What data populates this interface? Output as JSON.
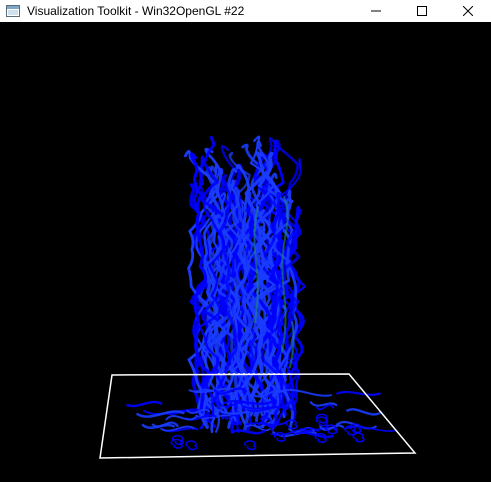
{
  "window": {
    "title": "Visualization Toolkit - Win32OpenGL #22",
    "icon": "vtk-window-icon",
    "controls": [
      "minimize-icon",
      "maximize-icon",
      "close-icon"
    ]
  },
  "render": {
    "background_color": "#000000",
    "outline_color": "#ffffff",
    "streamline_primary_color": "#0000ff",
    "streamline_secondary_color": "#1a3cff",
    "streamline_highlight_color": "#1f8a6a"
  }
}
